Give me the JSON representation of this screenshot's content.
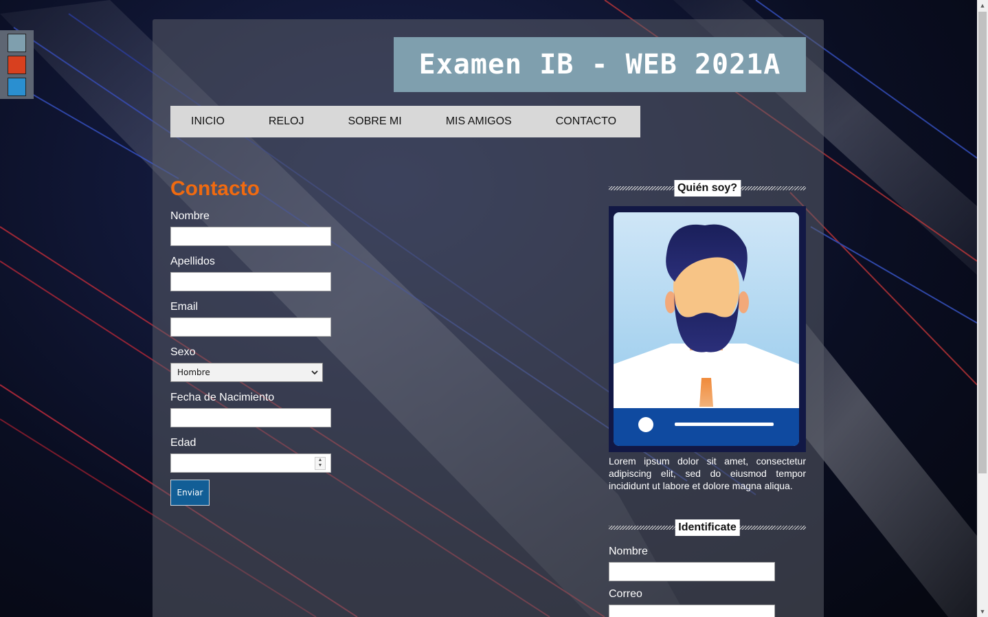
{
  "theme": {
    "swatches": [
      {
        "name": "grey-blue",
        "color": "#7f9fae"
      },
      {
        "name": "red",
        "color": "#d8401f"
      },
      {
        "name": "blue",
        "color": "#2a8fd0"
      }
    ],
    "accent": "#f06a10",
    "title_bg": "#7f9fae",
    "button_bg": "#125e96"
  },
  "header": {
    "title": "Examen IB - WEB 2021A"
  },
  "nav": {
    "items": [
      "INICIO",
      "RELOJ",
      "SOBRE MI",
      "MIS AMIGOS",
      "CONTACTO"
    ]
  },
  "contact": {
    "heading": "Contacto",
    "fields": {
      "nombre": {
        "label": "Nombre",
        "value": ""
      },
      "apellidos": {
        "label": "Apellidos",
        "value": ""
      },
      "email": {
        "label": "Email",
        "value": ""
      },
      "sexo": {
        "label": "Sexo",
        "selected": "Hombre"
      },
      "fecha": {
        "label": "Fecha de Nacimiento",
        "value": ""
      },
      "edad": {
        "label": "Edad",
        "value": ""
      }
    },
    "submit_label": "Enviar"
  },
  "sidebar": {
    "about": {
      "heading": "Quién soy?",
      "bio": "Lorem ipsum dolor sit amet, consectetur adipiscing elit, sed do eiusmod tempor incididunt ut labore et dolore magna aliqua."
    },
    "identify": {
      "heading": "Identificate",
      "nombre_label": "Nombre",
      "correo_label": "Correo"
    }
  }
}
